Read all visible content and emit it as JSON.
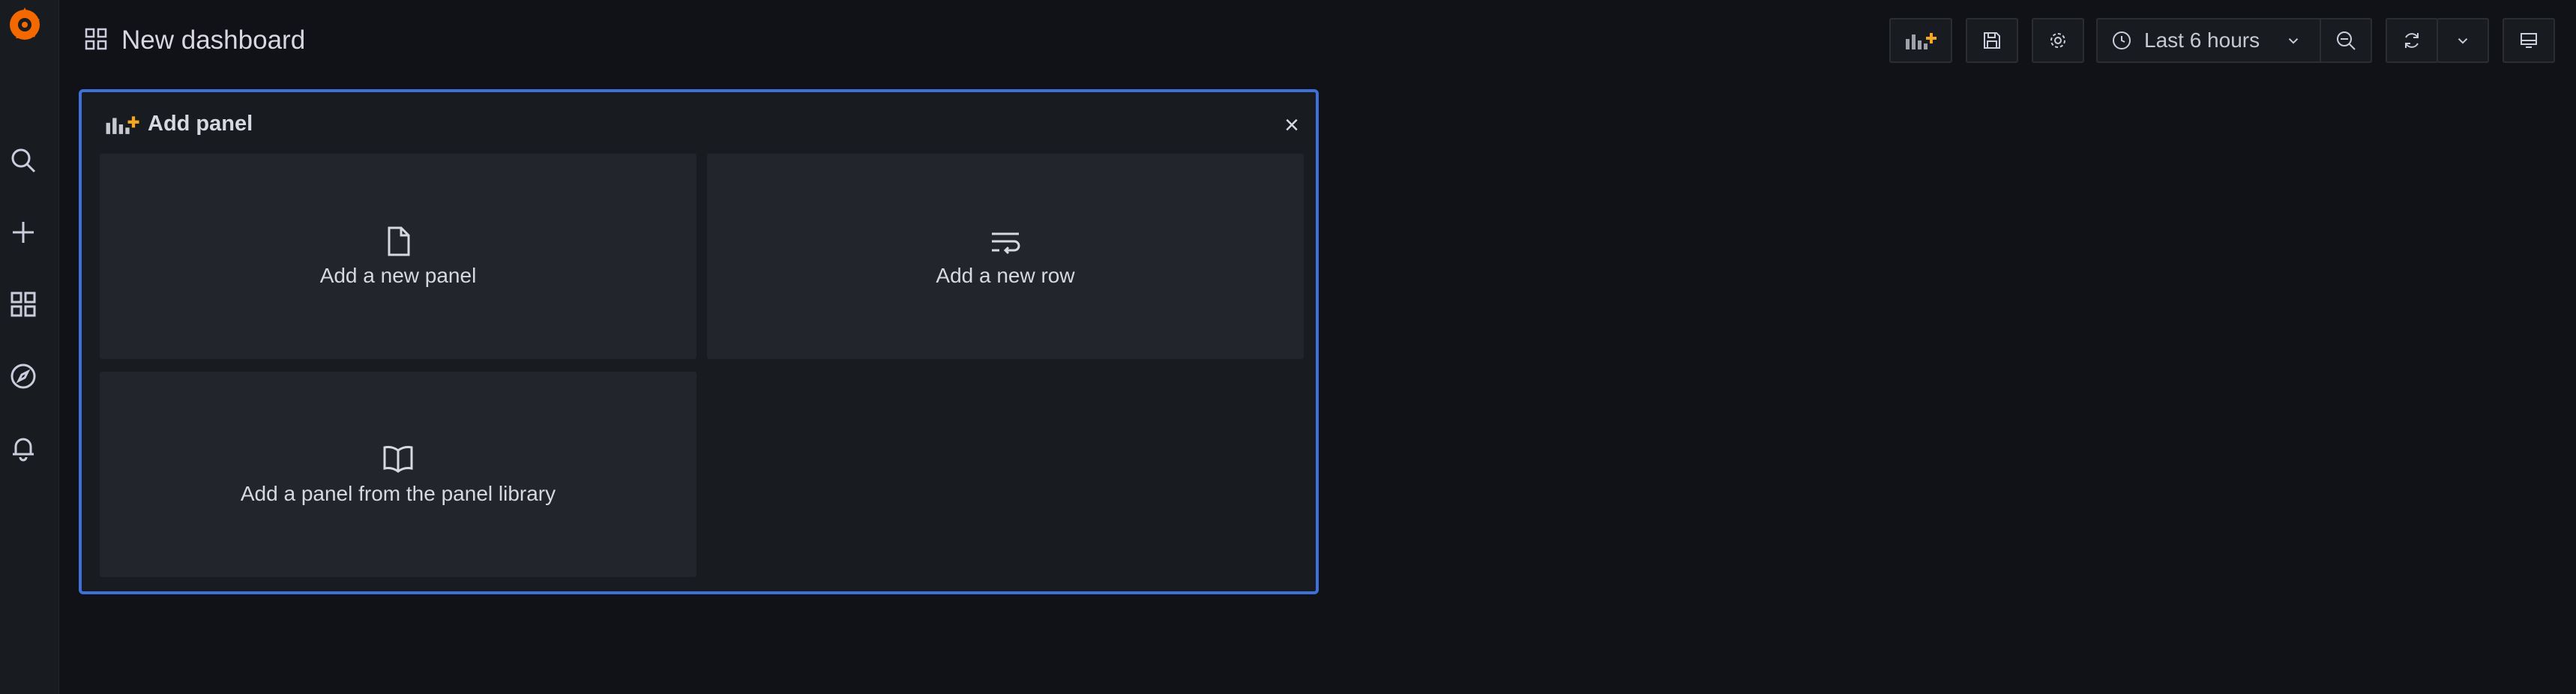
{
  "app": {
    "dashboard_title": "New dashboard",
    "brand_color": "#f46800",
    "accent_color": "#3d71d9"
  },
  "sidebar": {
    "items": [
      {
        "icon": "search-icon"
      },
      {
        "icon": "plus-icon"
      },
      {
        "icon": "dashboards-icon"
      },
      {
        "icon": "explore-compass-icon"
      },
      {
        "icon": "alerting-bell-icon"
      }
    ]
  },
  "toolbar": {
    "time_range_label": "Last 6 hours"
  },
  "add_panel": {
    "title": "Add panel",
    "close_glyph": "×",
    "options": [
      {
        "label": "Add a new panel",
        "icon": "file-icon"
      },
      {
        "label": "Add a new row",
        "icon": "row-wrap-icon"
      },
      {
        "label": "Add a panel from the panel library",
        "icon": "book-icon"
      }
    ]
  }
}
